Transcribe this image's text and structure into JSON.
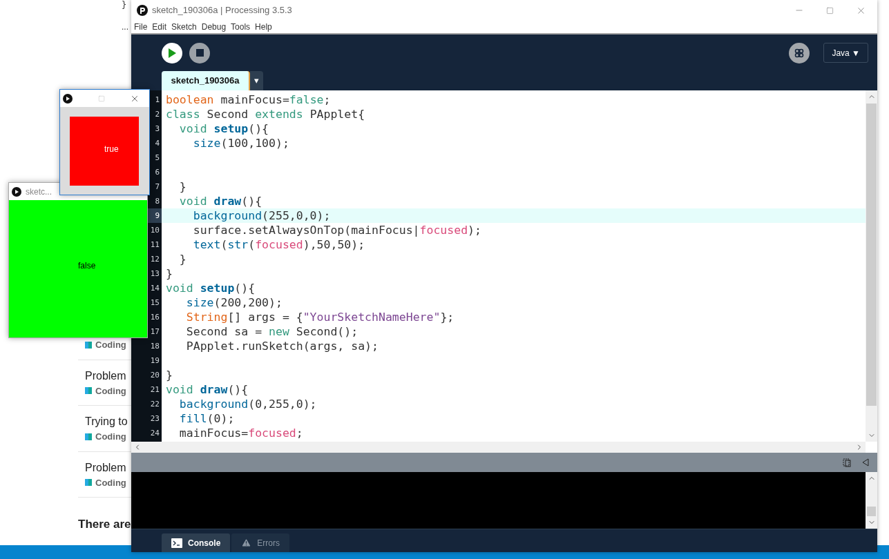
{
  "background_page": {
    "code_fragments": [
      "}",
      "..."
    ],
    "posts": [
      {
        "category": "Coding"
      },
      {
        "title": "Problem",
        "category": "Coding"
      },
      {
        "title": "Trying to",
        "category": "Coding"
      },
      {
        "title": "Problem",
        "category": "Coding"
      }
    ],
    "footer_text": "There are"
  },
  "editor": {
    "title": "sketch_190306a | Processing 3.5.3",
    "menu": [
      "File",
      "Edit",
      "Sketch",
      "Debug",
      "Tools",
      "Help"
    ],
    "mode": "Java ▼",
    "tabs": [
      {
        "label": "sketch_190306a",
        "selected": true
      }
    ],
    "tab_menu": "▾",
    "lines": [
      {
        "number": "1",
        "selected": false,
        "tokens": [
          {
            "type": "boolean"
          },
          {
            "plain": " mainFocus="
          },
          {
            "lit": "false"
          },
          {
            "plain": ";"
          }
        ]
      },
      {
        "number": "2",
        "selected": false,
        "tokens": [
          {
            "kw": "class"
          },
          {
            "plain": " Second "
          },
          {
            "kw": "extends"
          },
          {
            "plain": " PApplet{"
          }
        ]
      },
      {
        "number": "3",
        "selected": false,
        "tokens": [
          {
            "kw": "  void"
          },
          {
            "fn": " setup"
          },
          {
            "plain": "(){"
          }
        ]
      },
      {
        "number": "4",
        "selected": false,
        "tokens": [
          {
            "api": "    size"
          },
          {
            "plain": "(100,100);"
          }
        ]
      },
      {
        "number": "5",
        "selected": false
      },
      {
        "number": "6",
        "selected": false
      },
      {
        "number": "7",
        "selected": false,
        "tokens": [
          {
            "plain": "  }"
          }
        ]
      },
      {
        "number": "8",
        "selected": false,
        "tokens": [
          {
            "kw": "  void"
          },
          {
            "fn": " draw"
          },
          {
            "plain": "(){"
          }
        ]
      },
      {
        "number": "9",
        "selected": true,
        "tokens": [
          {
            "api": "    background"
          },
          {
            "plain": "(255,0,0);"
          }
        ]
      },
      {
        "number": "10",
        "selected": false,
        "tokens": [
          {
            "plain": "    surface.setAlwaysOnTop(mainFocus|"
          },
          {
            "var": "focused"
          },
          {
            "plain": ");"
          }
        ]
      },
      {
        "number": "11",
        "selected": false,
        "tokens": [
          {
            "api": "    text"
          },
          {
            "plain": "("
          },
          {
            "api": "str"
          },
          {
            "plain": "("
          },
          {
            "var": "focused"
          },
          {
            "plain": "),50,50);"
          }
        ]
      },
      {
        "number": "12",
        "selected": false,
        "tokens": [
          {
            "plain": "  }"
          }
        ]
      },
      {
        "number": "13",
        "selected": false,
        "tokens": [
          {
            "plain": "}"
          }
        ]
      },
      {
        "number": "14",
        "selected": false,
        "tokens": [
          {
            "kw": "void"
          },
          {
            "fn": " setup"
          },
          {
            "plain": "(){"
          }
        ]
      },
      {
        "number": "15",
        "selected": false,
        "tokens": [
          {
            "api": "   size"
          },
          {
            "plain": "(200,200);"
          }
        ]
      },
      {
        "number": "16",
        "selected": false,
        "tokens": [
          {
            "type": "   String"
          },
          {
            "plain": "[] args = {"
          },
          {
            "str": "\"YourSketchNameHere\""
          },
          {
            "plain": "};"
          }
        ]
      },
      {
        "number": "17",
        "selected": false,
        "tokens": [
          {
            "plain": "   Second sa = "
          },
          {
            "kw": "new"
          },
          {
            "plain": " Second();"
          }
        ]
      },
      {
        "number": "18",
        "selected": false,
        "tokens": [
          {
            "plain": "   PApplet.runSketch(args, sa);"
          }
        ]
      },
      {
        "number": "19",
        "selected": false
      },
      {
        "number": "20",
        "selected": false,
        "tokens": [
          {
            "plain": "}"
          }
        ]
      },
      {
        "number": "21",
        "selected": false,
        "tokens": [
          {
            "kw": "void"
          },
          {
            "fn": " draw"
          },
          {
            "plain": "(){"
          }
        ]
      },
      {
        "number": "22",
        "selected": false,
        "tokens": [
          {
            "api": "  background"
          },
          {
            "plain": "(0,255,0);"
          }
        ]
      },
      {
        "number": "23",
        "selected": false,
        "tokens": [
          {
            "api": "  fill"
          },
          {
            "plain": "(0);"
          }
        ]
      },
      {
        "number": "24",
        "selected": false,
        "tokens": [
          {
            "plain": "  mainFocus="
          },
          {
            "var": "focused"
          },
          {
            "plain": ";"
          }
        ]
      }
    ],
    "console_tabs": [
      {
        "label": "Console",
        "kind": "console",
        "selected": true
      },
      {
        "label": "Errors",
        "kind": "errors",
        "selected": false
      }
    ]
  },
  "sketch_windows": [
    {
      "title": "sketc...",
      "output": "false",
      "color": "#00ff00",
      "kind": "full"
    },
    {
      "output": "true",
      "color": "#ff0000",
      "kind": "inset"
    }
  ]
}
